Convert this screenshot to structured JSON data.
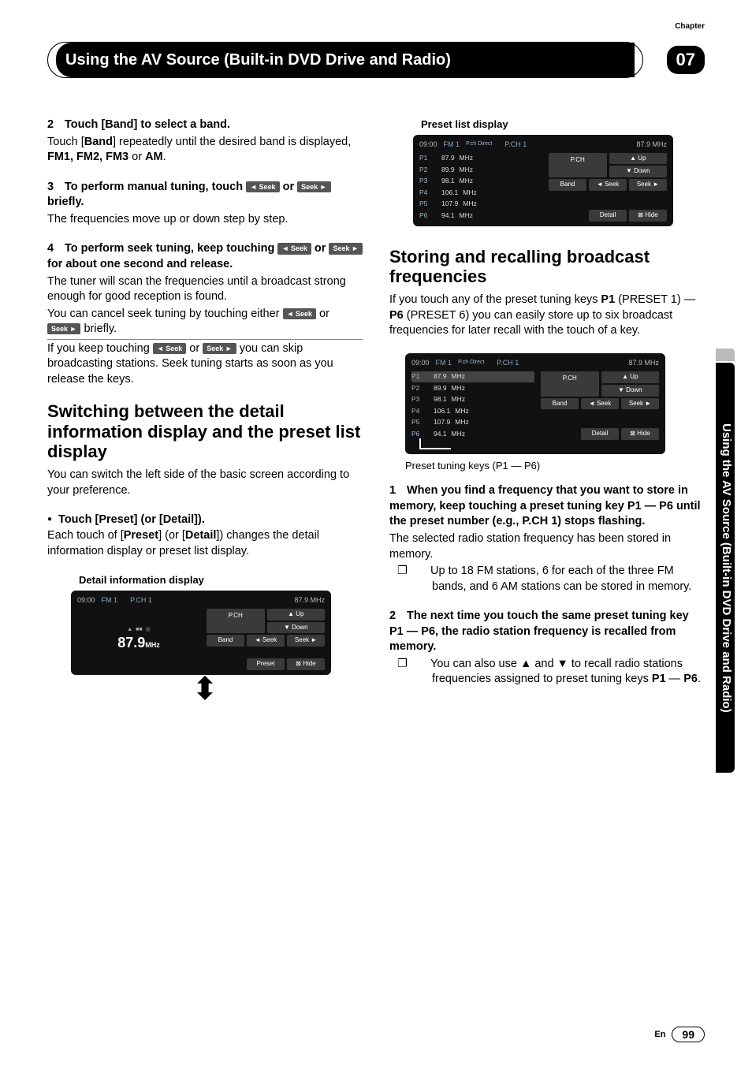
{
  "chapter_label": "Chapter",
  "chapter_num": "07",
  "header_title": "Using the AV Source (Built-in DVD Drive and Radio)",
  "side_tab": "Using the AV Source (Built-in DVD Drive and Radio)",
  "left": {
    "step2_head": "Touch [Band] to select a band.",
    "step2_body_a": "Touch [",
    "step2_body_b": "] repeatedly until the desired band is displayed, ",
    "step2_bold_band": "Band",
    "step2_bands": "FM1, FM2, FM3",
    "step2_or": " or ",
    "step2_am": "AM",
    "step3_head_a": "To perform manual tuning, touch ",
    "step3_head_b": " or ",
    "step3_head_c": " briefly.",
    "step3_body": "The frequencies move up or down step by step.",
    "step4_head_a": "To perform seek tuning, keep touching ",
    "step4_head_b": " or ",
    "step4_head_c": " for about one second and release.",
    "step4_body1": "The tuner will scan the frequencies until a broadcast strong enough for good reception is found.",
    "step4_body2_a": "You can cancel seek tuning by touching either ",
    "step4_body2_b": " or ",
    "step4_body2_c": " briefly.",
    "step4_body3_a": "If you keep touching ",
    "step4_body3_b": " or ",
    "step4_body3_c": " you can skip broadcasting stations. Seek tuning starts as soon as you release the keys.",
    "h2_switch": "Switching between the detail information display and the preset list display",
    "switch_body": "You can switch the left side of the basic screen according to your preference.",
    "touch_preset_head": "Touch [Preset] (or [Detail]).",
    "touch_preset_body_a": "Each touch of [",
    "touch_preset_body_b": "] (or [",
    "touch_preset_body_c": "]) changes the detail information display or preset list display.",
    "preset_word": "Preset",
    "detail_word": "Detail",
    "caption_detail": "Detail information display"
  },
  "right": {
    "caption_preset": "Preset list display",
    "h2_storing": "Storing and recalling broadcast frequencies",
    "storing_body_a": "If you touch any of the preset tuning keys ",
    "storing_body_b": " (PRESET 1) — ",
    "storing_body_c": " (PRESET 6) you can easily store up to six broadcast frequencies for later recall with the touch of a key.",
    "p1": "P1",
    "p6": "P6",
    "caption_tuning": "Preset tuning keys (P1 — P6)",
    "step1_head": "When you find a frequency that you want to store in memory, keep touching a preset tuning key P1 — P6 until the preset number (e.g., P.CH 1) stops flashing.",
    "step1_body": "The selected radio station frequency has been stored in memory.",
    "note1": "Up to 18 FM stations, 6 for each of the three FM bands, and 6 AM stations can be stored in memory.",
    "step2_head": "The next time you touch the same preset tuning key P1 — P6, the radio station frequency is recalled from memory.",
    "note2_a": "You can also use ▲ and ▼ to recall radio stations frequencies assigned to preset tuning keys ",
    "note2_b": " — ",
    "note2_c": "."
  },
  "seek": {
    "left": "◄ Seek",
    "right": "Seek ►"
  },
  "radio": {
    "time": "09:00",
    "fm": "FM",
    "one": "1",
    "pchdir": "P.ch Direct",
    "pch1": "P.CH",
    "pchnum": "1",
    "freq_top": "87.9 MHz",
    "presets": [
      {
        "p": "P1",
        "f": "87.9",
        "u": "MHz"
      },
      {
        "p": "P2",
        "f": "89.9",
        "u": "MHz"
      },
      {
        "p": "P3",
        "f": "98.1",
        "u": "MHz"
      },
      {
        "p": "P4",
        "f": "106.1",
        "u": "MHz"
      },
      {
        "p": "P5",
        "f": "107.9",
        "u": "MHz"
      },
      {
        "p": "P6",
        "f": "94.1",
        "u": "MHz"
      }
    ],
    "btns": {
      "pch": "P.CH",
      "up": "▲ Up",
      "down": "▼ Down",
      "band": "Band",
      "seekl": "◄ Seek",
      "seekr": "Seek ►",
      "detail": "Detail",
      "preset": "Preset",
      "hide": "⊠ Hide"
    },
    "detail_freq": "87.9",
    "detail_unit": "MHz"
  },
  "footer": {
    "lang": "En",
    "page": "99"
  }
}
